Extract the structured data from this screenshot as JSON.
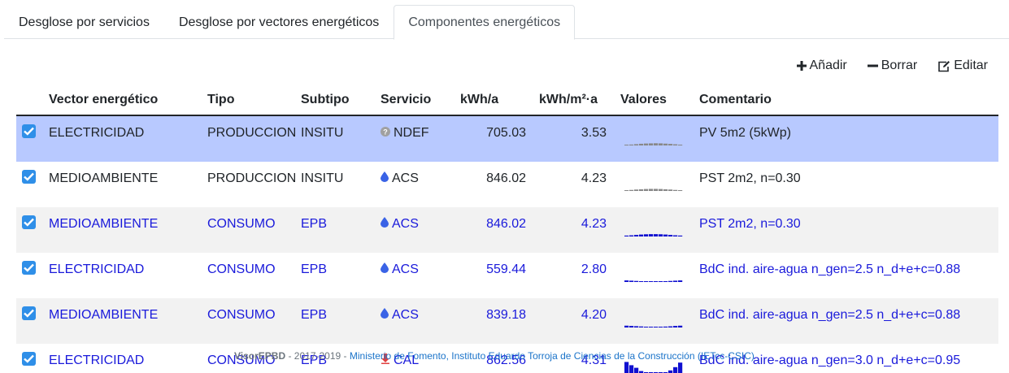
{
  "tabs": [
    {
      "label": "Desglose por servicios"
    },
    {
      "label": "Desglose por vectores energéticos"
    },
    {
      "label": "Componentes energéticos"
    }
  ],
  "toolbar": {
    "add": "Añadir",
    "delete": "Borrar",
    "edit": "Editar"
  },
  "table": {
    "headers": [
      "Vector energético",
      "Tipo",
      "Subtipo",
      "Servicio",
      "kWh/a",
      "kWh/m²·a",
      "Valores",
      "Comentario"
    ],
    "rows": [
      {
        "vector": "ELECTRICIDAD",
        "tipo": "PRODUCCION",
        "subtipo": "INSITU",
        "servicio": "NDEF",
        "service_icon": "question-circle-icon",
        "kwh": "705.03",
        "kwhm2": "3.53",
        "comentario": "PV 5m2 (5kWp)",
        "checked": true,
        "state": "selected"
      },
      {
        "vector": "MEDIOAMBIENTE",
        "tipo": "PRODUCCION",
        "subtipo": "INSITU",
        "servicio": "ACS",
        "service_icon": "drop-icon",
        "kwh": "846.02",
        "kwhm2": "4.23",
        "comentario": "PST 2m2, n=0.30",
        "checked": true,
        "state": "plain"
      },
      {
        "vector": "MEDIOAMBIENTE",
        "tipo": "CONSUMO",
        "subtipo": "EPB",
        "servicio": "ACS",
        "service_icon": "drop-icon",
        "kwh": "846.02",
        "kwhm2": "4.23",
        "comentario": "PST 2m2, n=0.30",
        "checked": true,
        "state": "striped"
      },
      {
        "vector": "ELECTRICIDAD",
        "tipo": "CONSUMO",
        "subtipo": "EPB",
        "servicio": "ACS",
        "service_icon": "drop-icon",
        "kwh": "559.44",
        "kwhm2": "2.80",
        "comentario": "BdC ind. aire-agua n_gen=2.5 n_d+e+c=0.88",
        "checked": true,
        "state": "plain"
      },
      {
        "vector": "MEDIOAMBIENTE",
        "tipo": "CONSUMO",
        "subtipo": "EPB",
        "servicio": "ACS",
        "service_icon": "drop-icon",
        "kwh": "839.18",
        "kwhm2": "4.20",
        "comentario": "BdC ind. aire-agua n_gen=2.5 n_d+e+c=0.88",
        "checked": true,
        "state": "striped"
      },
      {
        "vector": "ELECTRICIDAD",
        "tipo": "CONSUMO",
        "subtipo": "EPB",
        "servicio": "CAL",
        "service_icon": "heat-down-arrow-icon",
        "kwh": "862.56",
        "kwhm2": "4.31",
        "comentario": "BdC ind. aire-agua n_gen=3.0 n_d+e+c=0.95",
        "checked": true,
        "state": "plain"
      }
    ]
  },
  "sparklines": [
    {
      "color": "#888888",
      "values": [
        0.05,
        0.07,
        0.1,
        0.13,
        0.15,
        0.16,
        0.17,
        0.16,
        0.14,
        0.12,
        0.09,
        0.06
      ]
    },
    {
      "color": "#888888",
      "values": [
        0.06,
        0.08,
        0.11,
        0.13,
        0.15,
        0.16,
        0.16,
        0.15,
        0.13,
        0.11,
        0.08,
        0.06
      ]
    },
    {
      "color": "#1010d0",
      "values": [
        0.07,
        0.09,
        0.12,
        0.15,
        0.17,
        0.18,
        0.18,
        0.17,
        0.15,
        0.12,
        0.09,
        0.07
      ]
    },
    {
      "color": "#1010d0",
      "values": [
        0.12,
        0.1,
        0.08,
        0.06,
        0.05,
        0.05,
        0.05,
        0.05,
        0.06,
        0.08,
        0.1,
        0.12
      ]
    },
    {
      "color": "#1010d0",
      "values": [
        0.14,
        0.12,
        0.1,
        0.08,
        0.06,
        0.05,
        0.05,
        0.05,
        0.07,
        0.09,
        0.12,
        0.14
      ]
    },
    {
      "color": "#1010d0",
      "values": [
        0.85,
        0.6,
        0.4,
        0.15,
        0.05,
        0.02,
        0.02,
        0.02,
        0.05,
        0.2,
        0.45,
        0.8
      ]
    }
  ],
  "footer": {
    "app": "VisorEPBD",
    "years": " - 2017-2019 - ",
    "credits": "Ministerio de Fomento, Instituto Eduardo Torroja de Ciencias de la Construcción (IETcc-CSIC)"
  }
}
